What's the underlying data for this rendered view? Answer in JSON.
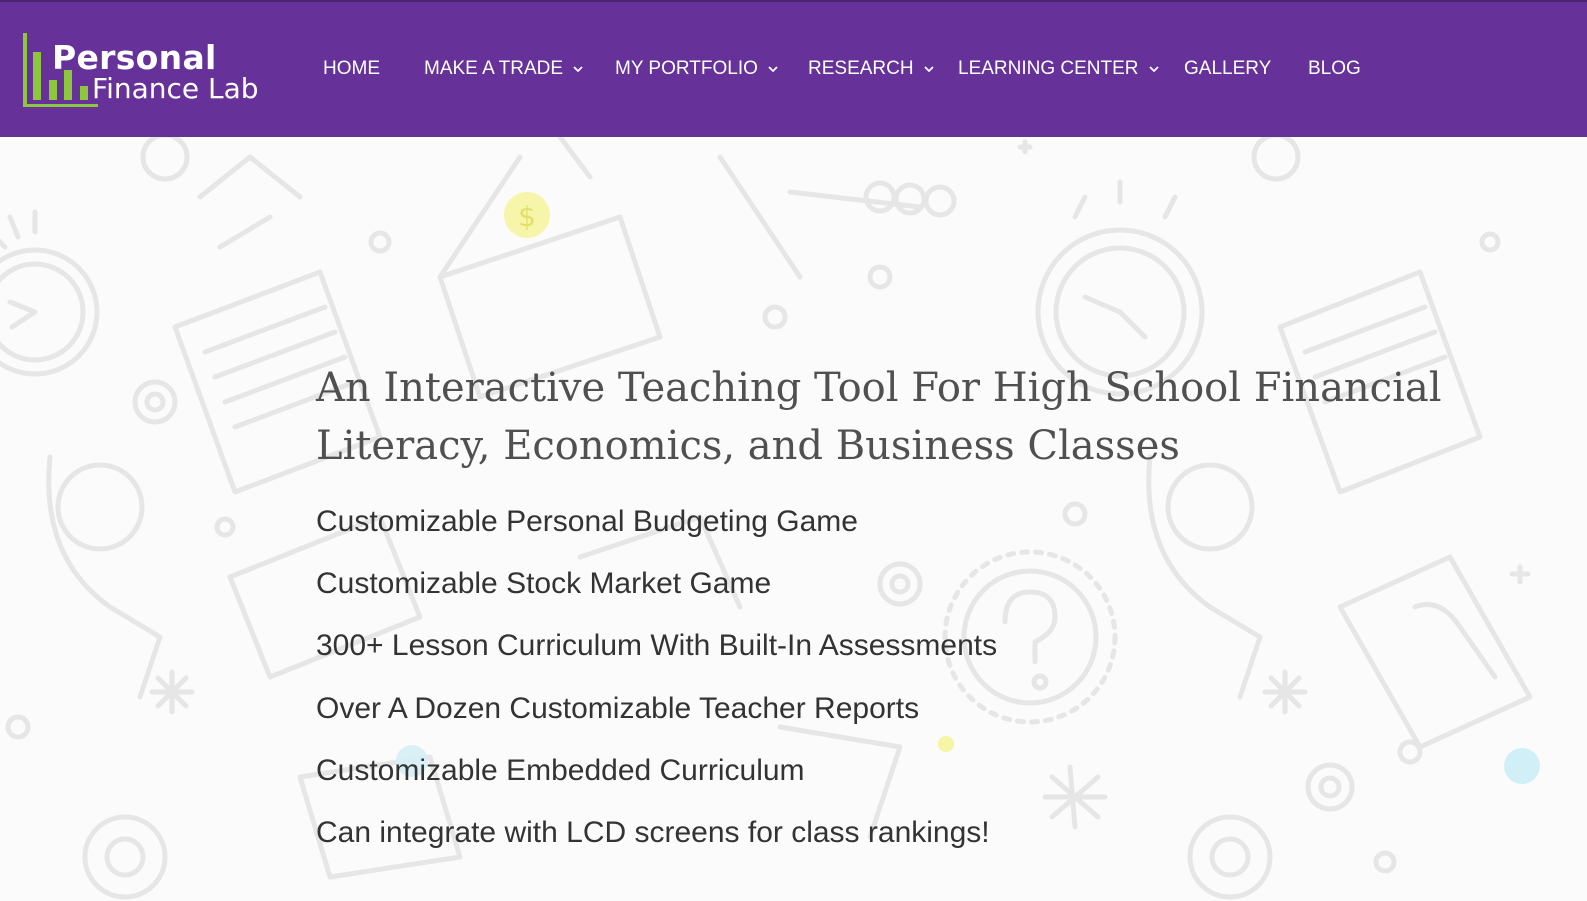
{
  "header": {
    "logo": {
      "line1": "Personal",
      "line2": "Finance Lab"
    },
    "nav": [
      {
        "label": "HOME",
        "has_dropdown": false
      },
      {
        "label": "MAKE A TRADE",
        "has_dropdown": true
      },
      {
        "label": "MY PORTFOLIO",
        "has_dropdown": true
      },
      {
        "label": "RESEARCH",
        "has_dropdown": true
      },
      {
        "label": "LEARNING CENTER",
        "has_dropdown": true
      },
      {
        "label": "GALLERY",
        "has_dropdown": false
      },
      {
        "label": "BLOG",
        "has_dropdown": false
      }
    ]
  },
  "hero": {
    "headline": "An Interactive Teaching Tool For High School Financial Literacy, Economics, and Business Classes",
    "features": [
      "Customizable Personal Budgeting Game",
      "Customizable Stock Market Game",
      "300+ Lesson Curriculum With Built-In Assessments",
      "Over A Dozen Customizable Teacher Reports",
      "Customizable Embedded Curriculum",
      "Can integrate with LCD screens for class rankings!"
    ]
  },
  "colors": {
    "nav_background": "#66329a",
    "logo_accent": "#8dc63f",
    "headline_text": "#505050",
    "body_text": "#333333",
    "background": "#fbfbfb",
    "doodle_stroke": "#e6e6e6"
  },
  "icons": [
    "logo-bar-chart-icon",
    "chevron-down-icon"
  ]
}
